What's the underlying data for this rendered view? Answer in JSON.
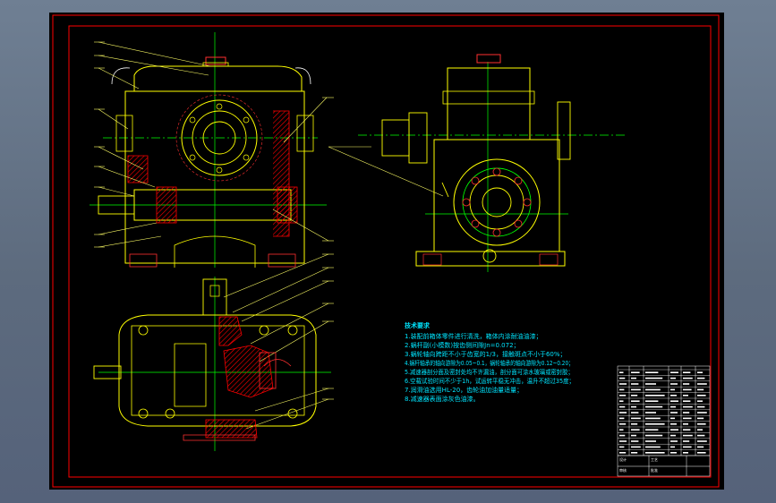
{
  "colors": {
    "background": "#000000",
    "frame": "#ff0000",
    "outline": "#ffff00",
    "centerline": "#00ff00",
    "leader": "#ffff66",
    "hatch": "#ff0000",
    "notes": "#00e5ff",
    "dimension": "#ffffff",
    "window_chrome": "#6f7f93"
  },
  "notes": {
    "title": "技术要求",
    "lines": [
      "1.装配前箱体零件进行清洗，箱体内涂耐油油漆；",
      "2.蜗杆副(小模数)按齿侧间隙Jn=0.072；",
      "3.蜗轮轴向跨距不小于齿宽的1/3，接触斑点不小于60%；",
      "4.蜗杆轴承的轴向游隙为0.05~0.1，蜗轮轴承的轴向游隙为0.12~0.20；",
      "5.减速器剖分面及密封处均不许漏油，剖分面可涂水玻璃或密封胶；",
      "6.空载试验时间不少于1h，试运转平稳无冲击，温升不超过35度；",
      "7.润滑油选用HL-20，齿轮油加油量适量；",
      "8.减速器表面涂灰色油漆。"
    ]
  },
  "title_block": {
    "rows": 15,
    "bottom_labels": [
      "设计",
      "审核",
      "工艺",
      "批准"
    ]
  }
}
